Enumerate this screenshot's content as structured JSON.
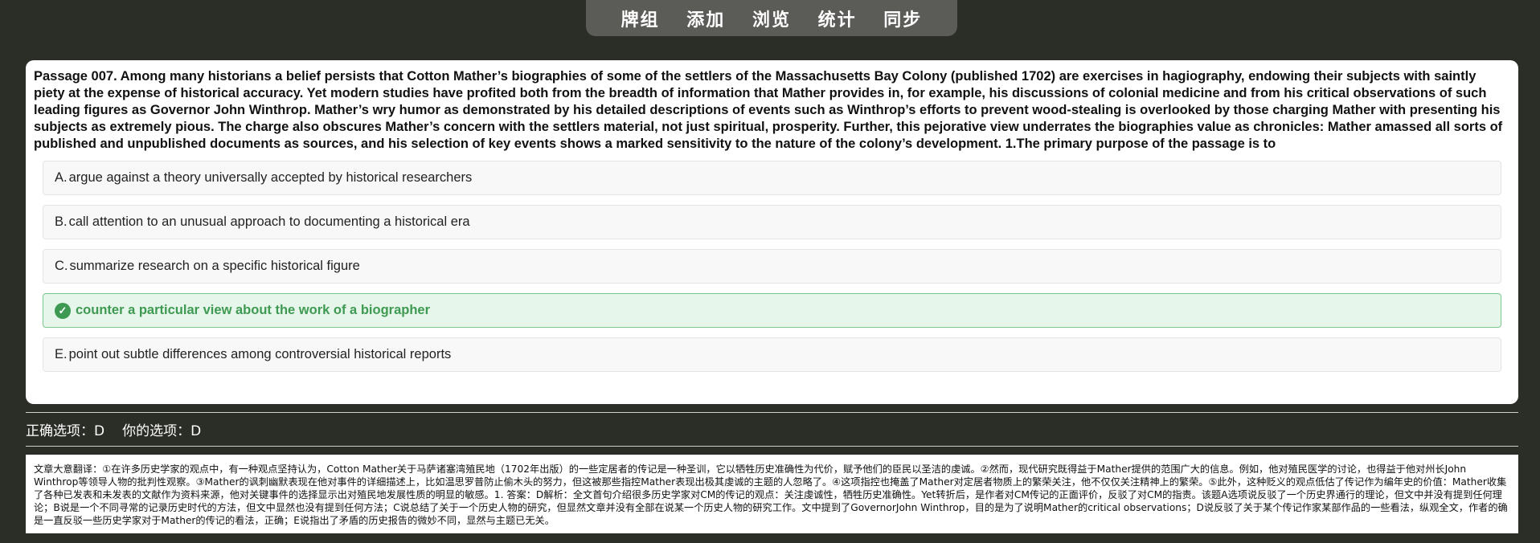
{
  "nav": {
    "items": [
      "牌组",
      "添加",
      "浏览",
      "统计",
      "同步"
    ]
  },
  "question": {
    "passage": "Passage 007. Among many historians a belief persists that Cotton Mather’s biographies of some of the settlers of the Massachusetts Bay Colony (published 1702) are exercises in hagiography, endowing their subjects with saintly piety at the expense of historical accuracy. Yet modern studies have profited both from the breadth of information that Mather provides in, for example, his discussions of colonial medicine and from his critical observations of such leading figures as Governor John Winthrop. Mather’s wry humor as demonstrated by his detailed descriptions of events such as Winthrop’s efforts to prevent wood-stealing is overlooked by those charging Mather with presenting his subjects as extremely pious. The charge also obscures Mather’s concern with the settlers material, not just spiritual, prosperity. Further, this pejorative view underrates the biographies value as chronicles: Mather amassed all sorts of published and unpublished documents as sources, and his selection of key events shows a marked sensitivity to the nature of the colony’s development. 1.The primary purpose of the passage is to",
    "options": [
      {
        "letter": "A.",
        "text": "argue against a theory universally accepted by historical researchers"
      },
      {
        "letter": "B.",
        "text": "call attention to an unusual approach to documenting a historical era"
      },
      {
        "letter": "C.",
        "text": "summarize research on a specific historical figure"
      },
      {
        "letter": "",
        "text": "counter a particular view about the work of a biographer"
      },
      {
        "letter": "E.",
        "text": "point out subtle differences among controversial historical reports"
      }
    ],
    "correct_icon": "check-circle-icon",
    "correct_color": "#3e9a52"
  },
  "result": {
    "correct_label": "正确选项：D",
    "your_label": "你的选项：D"
  },
  "explanation": {
    "text": "文章大意翻译：①在许多历史学家的观点中，有一种观点坚持认为，Cotton Mather关于马萨诸塞湾殖民地（1702年出版）的一些定居者的传记是一种圣训，它以牺牲历史准确性为代价，赋予他们的臣民以圣洁的虔诚。②然而，现代研究既得益于Mather提供的范围广大的信息。例如，他对殖民医学的讨论，也得益于他对州长John Winthrop等领导人物的批判性观察。③Mather的讽刺幽默表现在他对事件的详细描述上，比如温思罗普防止偷木头的努力，但这被那些指控Mather表现出极其虔诚的主题的人忽略了。④这项指控也掩盖了Mather对定居者物质上的繁荣关注，他不仅仅关注精神上的繁荣。⑤此外，这种贬义的观点低估了传记作为编年史的价值：Mather收集了各种已发表和未发表的文献作为资料来源，他对关键事件的选择显示出对殖民地发展性质的明显的敏感。1. 答案：D解析：全文首句介绍很多历史学家对CM的传记的观点：关注虔诚性，牺牲历史准确性。Yet转折后，是作者对CM传记的正面评价，反驳了对CM的指责。该题A选项说反驳了一个历史界通行的理论，但文中并没有提到任何理论；B说是一个不同寻常的记录历史时代的方法，但文中显然也没有提到任何方法；C说总结了关于一个历史人物的研究，但显然文章并没有全部在说某一个历史人物的研究工作。文中提到了GovernorJohn Winthrop，目的是为了说明Mather的critical observations；D说反驳了关于某个传记作家某部作品的一些看法，纵观全文，作者的确是一直反驳一些历史学家对于Mather的传记的看法，正确；E说指出了矛盾的历史报告的微妙不同，显然与主题已无关。"
  }
}
